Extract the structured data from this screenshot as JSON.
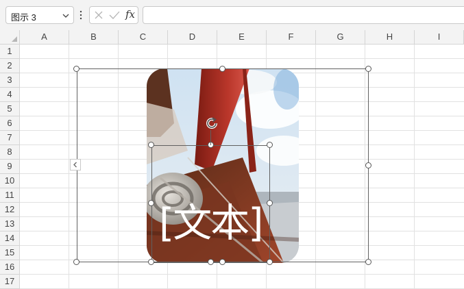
{
  "formula_bar": {
    "name_box_value": "图示 3",
    "fx_label": "fx",
    "formula_value": ""
  },
  "columns": [
    "A",
    "B",
    "C",
    "D",
    "E",
    "F",
    "G",
    "H",
    "I"
  ],
  "rows": [
    "1",
    "2",
    "3",
    "4",
    "5",
    "6",
    "7",
    "8",
    "9",
    "10",
    "11",
    "12",
    "13",
    "14",
    "15",
    "16",
    "17"
  ],
  "smartart": {
    "placeholder_text": "[文本]"
  },
  "colors": {
    "header_bg": "#f3f3f3",
    "grid_line": "#e1e1e1",
    "selection_border": "#606060"
  },
  "icons": {
    "name_box_dropdown": "chevron-down-icon",
    "more": "vertical-ellipsis-icon",
    "cancel": "x-icon",
    "enter": "check-icon",
    "rotate": "rotate-icon",
    "expand_text_pane": "chevron-left-icon"
  }
}
